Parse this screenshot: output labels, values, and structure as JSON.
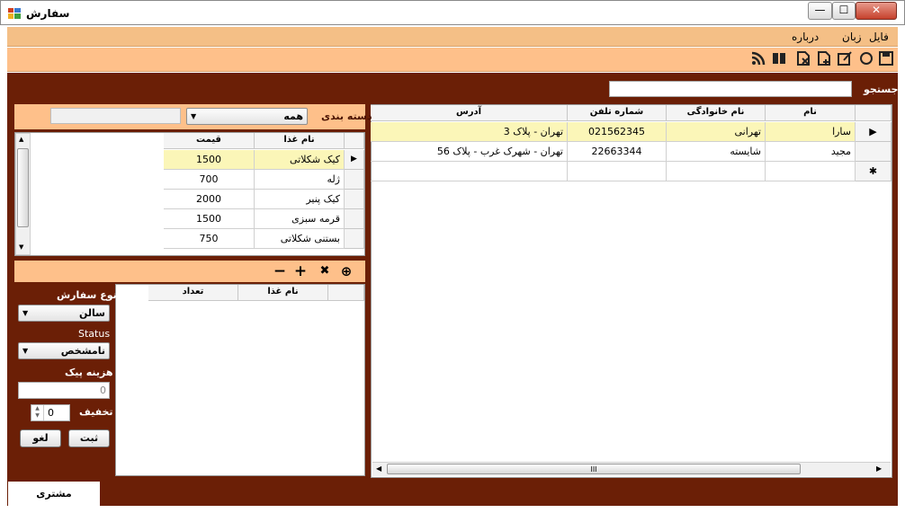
{
  "window": {
    "title": "سفارش",
    "min": "—",
    "max": "☐",
    "close": "✕"
  },
  "menu": {
    "items": [
      "فایل",
      "زبان",
      "درباره"
    ]
  },
  "toolbar": {
    "icons": [
      "save-icon",
      "refresh-icon",
      "edit-icon",
      "add-icon",
      "delete-icon",
      "book-icon",
      "rss-icon"
    ]
  },
  "search": {
    "label": "جستجو",
    "value": ""
  },
  "customers": {
    "headers": {
      "name": "نام",
      "family": "نام خانوادگی",
      "phone": "شماره تلفن",
      "address": "آدرس"
    },
    "rows": [
      {
        "name": "سارا",
        "family": "تهرانی",
        "phone": "021562345",
        "address": "تهران - پلاک 3",
        "marker": "▶"
      },
      {
        "name": "مجید",
        "family": "شایسته",
        "phone": "22663344",
        "address": "تهران - شهرک غرب - پلاک 56",
        "marker": ""
      }
    ],
    "new_row_marker": "✱"
  },
  "category": {
    "label": "دسته بندی",
    "selected": "همه",
    "arrow": "▼",
    "filter_value": ""
  },
  "foods": {
    "headers": {
      "name": "نام غذا",
      "price": "قیمت"
    },
    "rows": [
      {
        "name": "کیک شکلاتی",
        "price": "1500"
      },
      {
        "name": "ژله",
        "price": "700"
      },
      {
        "name": "کیک پنیر",
        "price": "2000"
      },
      {
        "name": "قرمه سبزی",
        "price": "1500"
      },
      {
        "name": "بستنی شکلاتی",
        "price": "750"
      }
    ],
    "selected_marker": "▶"
  },
  "order_toolbar": {
    "minus": "−",
    "plus": "+",
    "clear": "✖",
    "add": "⊕"
  },
  "order_items": {
    "headers": {
      "name": "نام غذا",
      "count": "تعداد"
    }
  },
  "order_form": {
    "type_label": "نوع سفارش",
    "type_value": "سالن",
    "status_label": "Status",
    "status_value": "نامشخص",
    "delivery_label": "هزینه پیک",
    "delivery_value": "0",
    "discount_label": "تخفیف",
    "discount_value": "0",
    "submit": "ثبت",
    "cancel": "لغو"
  },
  "tabs": {
    "customer": "مشتری"
  },
  "scroll": {
    "grip": "III"
  }
}
